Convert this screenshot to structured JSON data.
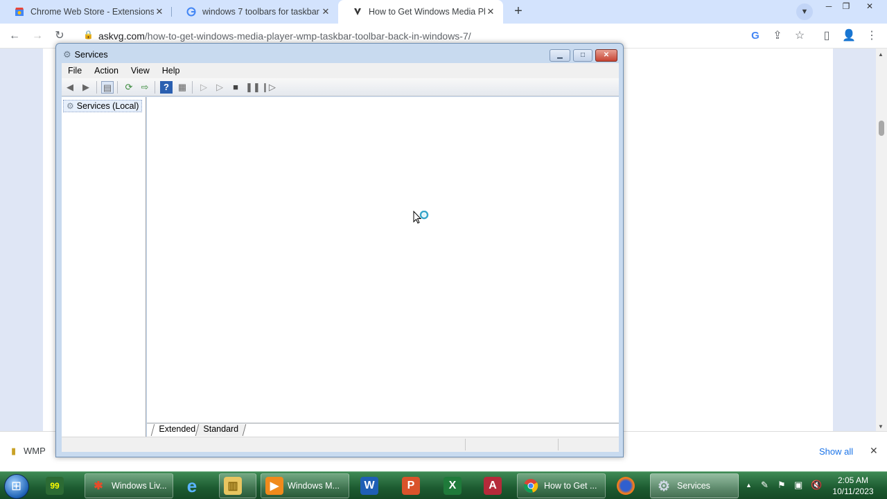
{
  "browser": {
    "tabs": [
      {
        "label": "Chrome Web Store - Extensions",
        "icon": "chrome-web-store-icon",
        "close": "✕"
      },
      {
        "label": "windows 7 toolbars for taskbar -",
        "icon": "google-icon",
        "close": "✕"
      },
      {
        "label": "How to Get Windows Media Play",
        "icon": "askvg-icon",
        "close": "✕"
      }
    ],
    "new_tab": "+",
    "url_domain": "askvg.com",
    "url_path": "/how-to-get-windows-media-player-wmp-taskbar-toolbar-back-in-windows-7/"
  },
  "services_window": {
    "title": "Services",
    "menu": [
      "File",
      "Action",
      "View",
      "Help"
    ],
    "tree_node": "Services (Local)",
    "view_tabs": [
      "Extended",
      "Standard"
    ]
  },
  "download_bar": {
    "item": "WMP",
    "show_all": "Show all"
  },
  "taskbar": {
    "items": [
      {
        "label": "Windows Liv...",
        "icon": "windows-live-icon"
      },
      {
        "label": "",
        "icon": "internet-explorer-icon"
      },
      {
        "label": "",
        "icon": "file-explorer-icon"
      },
      {
        "label": "Windows M...",
        "icon": "windows-media-player-icon"
      },
      {
        "label": "",
        "icon": "word-icon"
      },
      {
        "label": "",
        "icon": "powerpoint-icon"
      },
      {
        "label": "",
        "icon": "excel-icon"
      },
      {
        "label": "",
        "icon": "access-icon"
      },
      {
        "label": "How to Get ...",
        "icon": "chrome-icon"
      },
      {
        "label": "",
        "icon": "firefox-icon"
      },
      {
        "label": "Services",
        "icon": "services-icon"
      }
    ],
    "time": "2:05 AM",
    "date": "10/11/2023"
  }
}
